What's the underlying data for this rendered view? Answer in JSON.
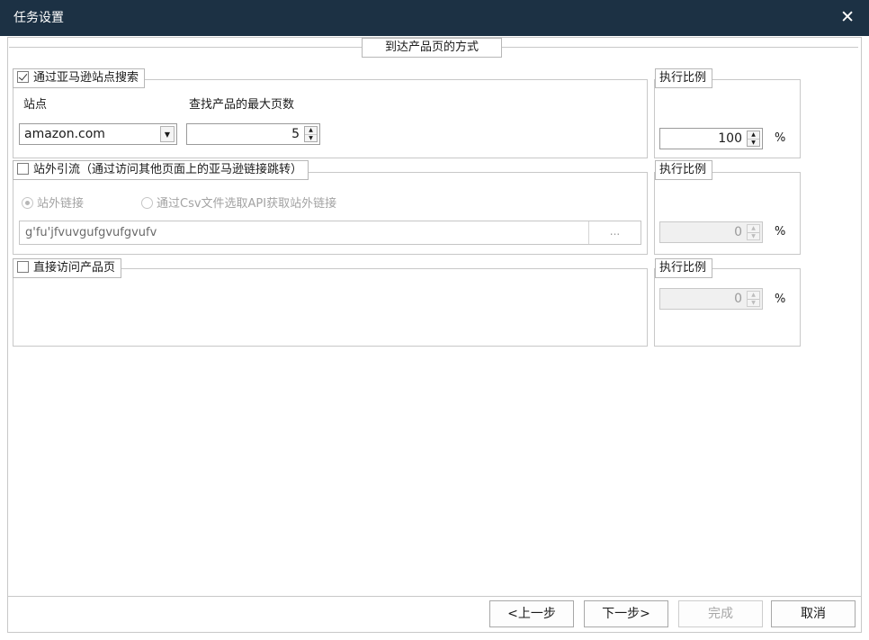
{
  "window": {
    "title": "任务设置",
    "close_glyph": "✕"
  },
  "section": {
    "title": "到达产品页的方式"
  },
  "group_amazon": {
    "legend": "通过亚马逊站点搜索",
    "checked": true,
    "site_label": "站点",
    "max_pages_label": "查找产品的最大页数",
    "site_value": "amazon.com",
    "max_pages_value": "5",
    "ratio_label": "执行比例",
    "ratio_value": "100",
    "ratio_unit": "%"
  },
  "group_offsite": {
    "legend": "站外引流（通过访问其他页面上的亚马逊链接跳转）",
    "checked": false,
    "radio_offsite_link": "站外链接",
    "radio_csv_api": "通过Csv文件选取API获取站外链接",
    "link_value": "g'fu'jfvuvgufgvufgvufv",
    "browse_label": "...",
    "ratio_label": "执行比例",
    "ratio_value": "0",
    "ratio_unit": "%"
  },
  "group_direct": {
    "legend": "直接访问产品页",
    "checked": false,
    "ratio_label": "执行比例",
    "ratio_value": "0",
    "ratio_unit": "%"
  },
  "buttons": {
    "prev": "<上一步",
    "next": "下一步>",
    "finish": "完成",
    "cancel": "取消"
  }
}
